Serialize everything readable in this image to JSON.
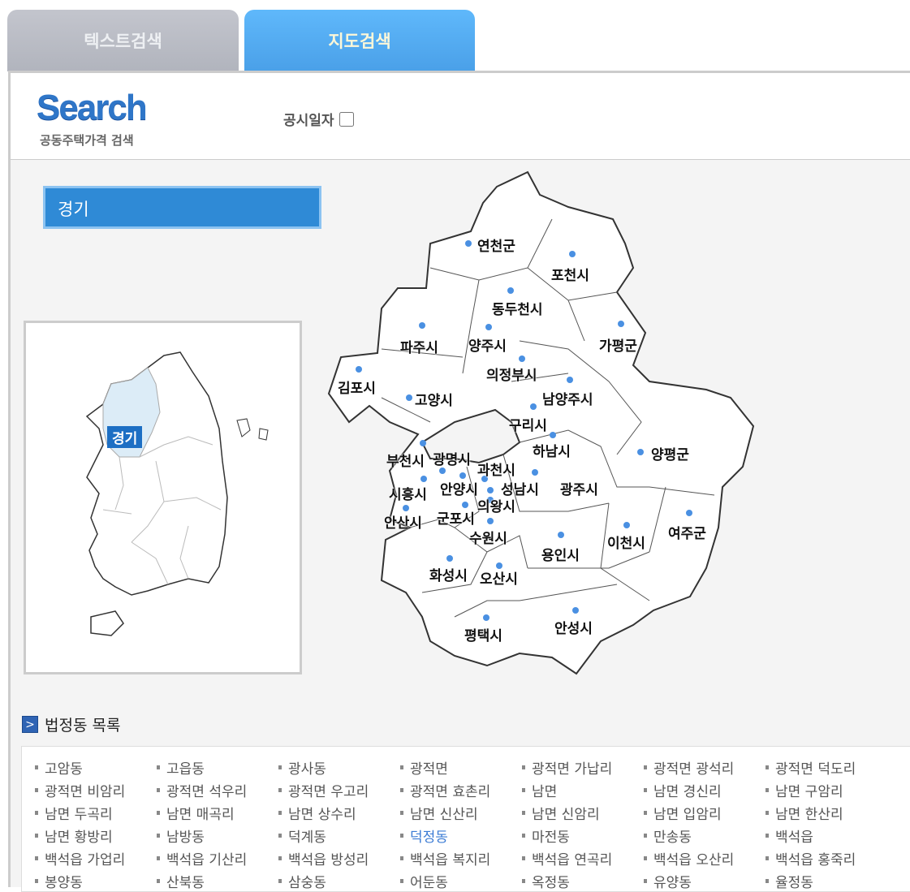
{
  "tabs": [
    {
      "label": "텍스트검색",
      "active": false
    },
    {
      "label": "지도검색",
      "active": true
    }
  ],
  "header": {
    "logo": "Search",
    "logo_sub": "공동주택가격 검색",
    "pubdate_label": "공시일자",
    "pubdate_checked": false
  },
  "region": {
    "selected": "경기"
  },
  "minimap": {
    "highlight_label": "경기",
    "highlight_color": "#dcecf7"
  },
  "map": {
    "cities": [
      "연천군",
      "포천시",
      "동두천시",
      "파주시",
      "양주시",
      "가평군",
      "의정부시",
      "김포시",
      "고양시",
      "남양주시",
      "구리시",
      "하남시",
      "양평군",
      "부천시",
      "광명시",
      "과천시",
      "시흥시",
      "안양시",
      "성남시",
      "광주시",
      "의왕시",
      "안산시",
      "군포시",
      "수원시",
      "이천시",
      "여주군",
      "용인시",
      "화성시",
      "오산시",
      "평택시",
      "안성시"
    ],
    "dot_color": "#4a90e2"
  },
  "section": {
    "title": "법정동 목록",
    "icon": "chevron-right-icon"
  },
  "dong_list": [
    "고암동",
    "고읍동",
    "광사동",
    "광적면",
    "광적면 가납리",
    "광적면 광석리",
    "광적면 덕도리",
    "광적면 비암리",
    "광적면 석우리",
    "광적면 우고리",
    "광적면 효촌리",
    "남면",
    "남면 경신리",
    "남면 구암리",
    "남면 두곡리",
    "남면 매곡리",
    "남면 상수리",
    "남면 신산리",
    "남면 신암리",
    "남면 입암리",
    "남면 한산리",
    "남면 황방리",
    "남방동",
    "덕계동",
    "덕정동",
    "마전동",
    "만송동",
    "백석읍",
    "백석읍 가업리",
    "백석읍 기산리",
    "백석읍 방성리",
    "백석읍 복지리",
    "백석읍 연곡리",
    "백석읍 오산리",
    "백석읍 홍죽리",
    "봉양동",
    "산북동",
    "삼숭동",
    "어둔동",
    "옥정동",
    "유양동",
    "율정동"
  ],
  "active_dong": "덕정동",
  "active_color": "#3b7bd4"
}
